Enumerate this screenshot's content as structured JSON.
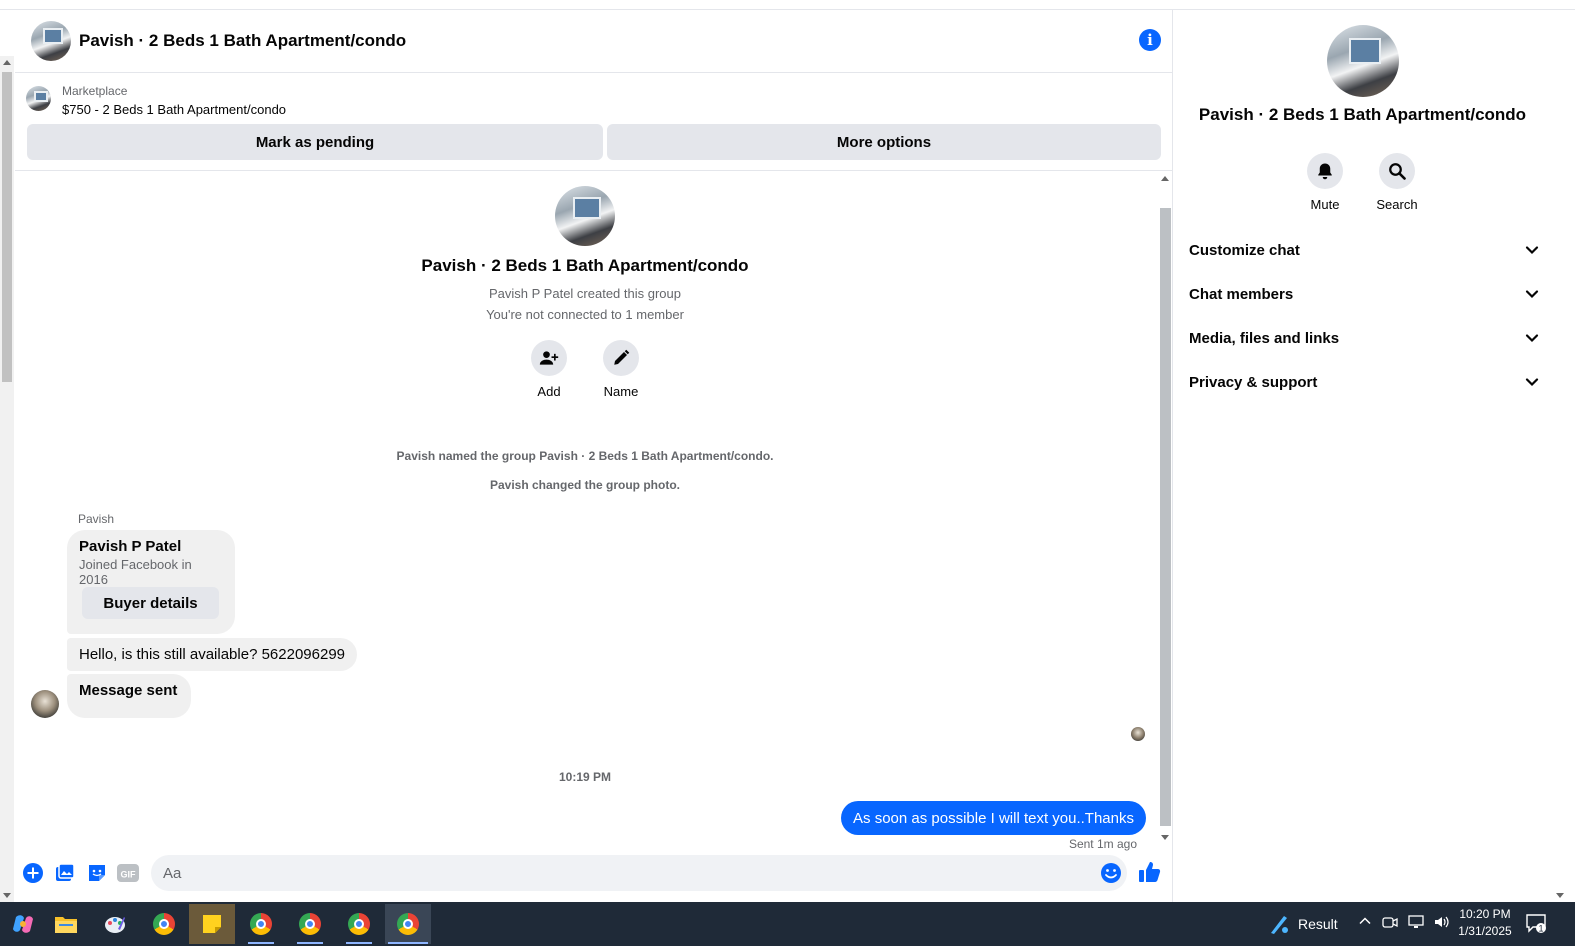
{
  "header": {
    "title": "Pavish · 2 Beds 1 Bath Apartment/condo",
    "info_icon": "i"
  },
  "listing": {
    "category": "Marketplace",
    "description": "$750 - 2 Beds 1 Bath Apartment/condo",
    "mark_pending_label": "Mark as pending",
    "more_options_label": "More options"
  },
  "intro": {
    "group_name": "Pavish · 2 Beds 1 Bath Apartment/condo",
    "created_by": "Pavish P Patel created this group",
    "not_connected": "You're not connected to 1 member",
    "add_label": "Add",
    "name_label": "Name"
  },
  "system_messages": [
    "Pavish named the group Pavish · 2 Beds 1 Bath Apartment/condo.",
    "Pavish changed the group photo."
  ],
  "conversation": {
    "sender": "Pavish",
    "card_name": "Pavish P Patel",
    "card_sub": "Joined Facebook in 2016",
    "buyer_details_label": "Buyer details",
    "msg_hello": "Hello, is this still available? 5622096299",
    "msg_sent": "Message sent",
    "timestamp": "10:19 PM",
    "outgoing": "As soon as possible I will text you..Thanks",
    "sent_ago": "Sent 1m ago"
  },
  "composer": {
    "placeholder": "Aa",
    "gif_label": "GIF"
  },
  "panel": {
    "title": "Pavish · 2 Beds 1 Bath Apartment/condo",
    "mute_label": "Mute",
    "search_label": "Search",
    "sections": [
      "Customize chat",
      "Chat members",
      "Media, files and links",
      "Privacy & support"
    ]
  },
  "taskbar": {
    "result_label": "Result",
    "time": "10:20 PM",
    "date": "1/31/2025",
    "notification_count": "1"
  },
  "colors": {
    "accent": "#0866ff",
    "bubble_gray": "#f0f0f0",
    "taskbar": "#1f2a38"
  }
}
